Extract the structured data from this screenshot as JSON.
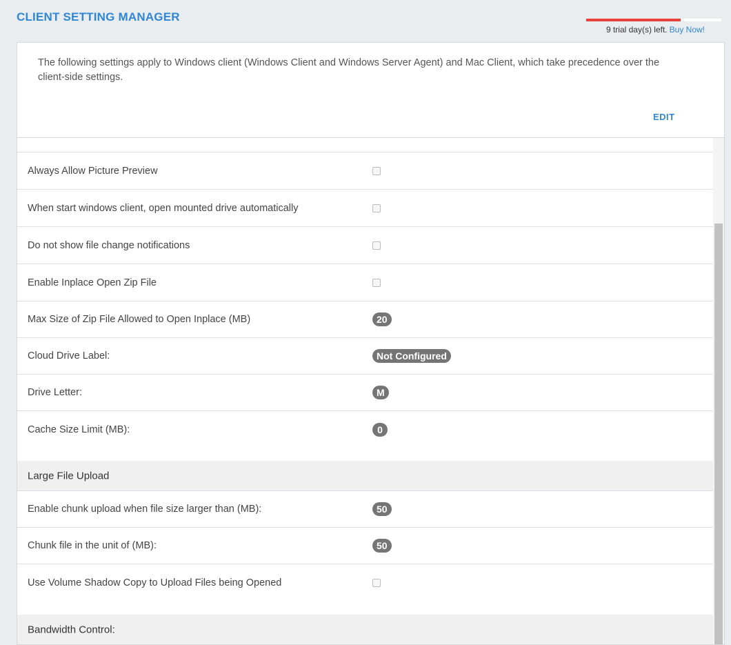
{
  "header": {
    "title": "CLIENT SETTING MANAGER",
    "trial_text": "9 trial day(s) left.",
    "buy_now": "Buy Now!",
    "trial_progress_fraction": 0.7
  },
  "info": {
    "description": "The following settings apply to Windows client (Windows Client and Windows Server Agent) and Mac Client, which take precedence over the client-side settings.",
    "edit_label": "EDIT"
  },
  "settings": [
    {
      "label": "Always Allow Picture Preview",
      "type": "checkbox",
      "checked": false
    },
    {
      "label": "When start windows client, open mounted drive automatically",
      "type": "checkbox",
      "checked": false
    },
    {
      "label": "Do not show file change notifications",
      "type": "checkbox",
      "checked": false
    },
    {
      "label": "Enable Inplace Open Zip File",
      "type": "checkbox",
      "checked": false
    },
    {
      "label": "Max Size of Zip File Allowed to Open Inplace (MB)",
      "type": "badge",
      "value": "20"
    },
    {
      "label": "Cloud Drive Label:",
      "type": "badge",
      "value": "Not Configured"
    },
    {
      "label": "Drive Letter:",
      "type": "badge",
      "value": "M"
    },
    {
      "label": "Cache Size Limit (MB):",
      "type": "badge",
      "value": "0"
    }
  ],
  "sections": {
    "large_file_upload": "Large File Upload",
    "bandwidth_control": "Bandwidth Control:"
  },
  "large_file_upload": [
    {
      "label": "Enable chunk upload when file size larger than (MB):",
      "type": "badge",
      "value": "50"
    },
    {
      "label": "Chunk file in the unit of (MB):",
      "type": "badge",
      "value": "50"
    },
    {
      "label": "Use Volume Shadow Copy to Upload Files being Opened",
      "type": "checkbox",
      "checked": false
    }
  ],
  "colors": {
    "accent": "#2e86d4",
    "trial_bar": "#e8423b",
    "badge": "#757575",
    "section_bg": "#f0f0f0"
  }
}
